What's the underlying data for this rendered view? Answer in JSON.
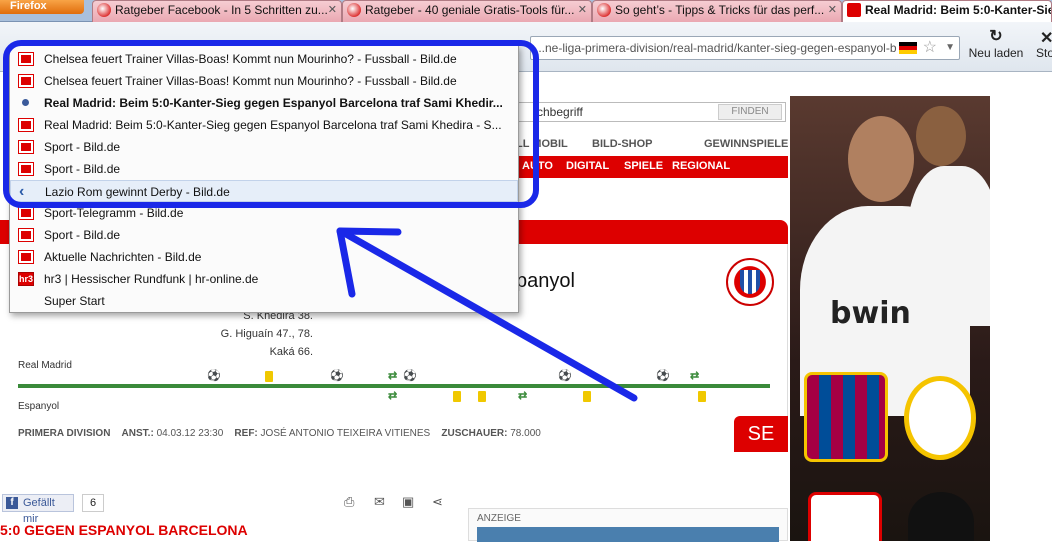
{
  "browser": {
    "app_button": "Firefox",
    "tabs": [
      {
        "label": "Ratgeber Facebook - In 5 Schritten zu...",
        "active": false
      },
      {
        "label": "Ratgeber - 40 geniale Gratis-Tools für...",
        "active": false
      },
      {
        "label": "So geht’s - Tipps & Tricks für das perf...",
        "active": false
      },
      {
        "label": "Real Madrid: Beim 5:0-Kanter-Sie",
        "active": true
      }
    ],
    "url": "...ne-liga-primera-division/real-madrid/kanter-sieg-gegen-espanyol-b",
    "reload_label": "Neu laden",
    "stop_label": "Sto"
  },
  "history_menu": {
    "items": [
      {
        "label": "Chelsea feuert Trainer Villas-Boas! Kommt nun Mourinho? - Fussball - Bild.de",
        "icon": "bild-favicon"
      },
      {
        "label": "Chelsea feuert Trainer Villas-Boas! Kommt nun Mourinho? - Fussball - Bild.de",
        "icon": "bild-favicon"
      },
      {
        "label": "Real Madrid: Beim 5:0-Kanter-Sieg gegen Espanyol Barcelona traf Sami Khedir...",
        "icon": "current-page-dot-icon"
      },
      {
        "label": "Real Madrid: Beim 5:0-Kanter-Sieg gegen Espanyol Barcelona traf Sami Khedira - S...",
        "icon": "bild-favicon"
      },
      {
        "label": "Sport - Bild.de",
        "icon": "bild-favicon"
      },
      {
        "label": "Sport - Bild.de",
        "icon": "bild-favicon"
      },
      {
        "label": "Lazio Rom gewinnt Derby - Bild.de",
        "icon": "back-arrow-icon"
      },
      {
        "label": "Sport-Telegramm - Bild.de",
        "icon": "bild-favicon"
      },
      {
        "label": "Sport - Bild.de",
        "icon": "bild-favicon"
      },
      {
        "label": "Aktuelle Nachrichten - Bild.de",
        "icon": "bild-favicon"
      },
      {
        "label": "hr3 | Hessischer Rundfunk | hr-online.de",
        "icon": "hr3-favicon"
      },
      {
        "label": "Super Start",
        "icon": "none"
      }
    ],
    "hr3_text": "hr3"
  },
  "site": {
    "search_value": "chbegriff",
    "search_button": "FINDEN",
    "topnav": [
      "LL MOBIL",
      "BILD-SHOP",
      "GEWINNSPIELE"
    ],
    "rednav": [
      "AUTO",
      "DIGITAL",
      "SPIELE",
      "REGIONAL"
    ]
  },
  "match": {
    "away_title_fragment": "panyol",
    "scorers": [
      "S. Khedira 38.",
      "G. Higuaín 47., 78.",
      "Kaká 66."
    ],
    "home_team": "Real Madrid",
    "away_team": "Espanyol",
    "badge": "SE",
    "meta": {
      "competition": "PRIMERA DIVISION",
      "kickoff_label": "ANST.:",
      "kickoff": "04.03.12 23:30",
      "referee_label": "REF:",
      "referee": "JOSÉ ANTONIO TEIXEIRA VITIENES",
      "spectators_label": "ZUSCHAUER:",
      "spectators": "78.000"
    }
  },
  "social": {
    "like_label": "Gefällt mir",
    "like_count": "6",
    "fb_letter": "f"
  },
  "article": {
    "headline": "5:0 GEGEN ESPANYOL BARCELONA",
    "ad_label": "ANZEIGE"
  },
  "banner": {
    "sponsor": "bwin"
  },
  "colors": {
    "annotation_blue": "#1a28e8",
    "bild_red": "#dd0000"
  }
}
